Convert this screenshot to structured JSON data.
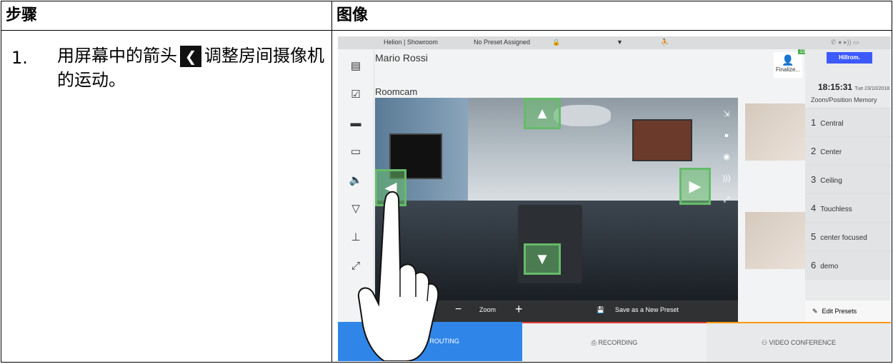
{
  "table": {
    "header_steps": "步骤",
    "header_image": "图像",
    "step_number": "1.",
    "step_text_before": "用屏幕中的箭头",
    "step_text_after": "调整房间摄像机的运动。"
  },
  "device": {
    "topbar": {
      "location": "Helion | Showroom",
      "preset_status": "No Preset Assigned"
    },
    "patient_name": "Mario Rossi",
    "finalize_label": "Finalize...",
    "finalize_badge": "13",
    "logo": "Hillrom.",
    "time": "18:15:31",
    "date": "Tue 23/10/2018",
    "zoom_memory_label": "Zoom/Position Memory",
    "presets": [
      {
        "num": "1",
        "name": "Central"
      },
      {
        "num": "2",
        "name": "Center"
      },
      {
        "num": "3",
        "name": "Ceiling"
      },
      {
        "num": "4",
        "name": "Touchless"
      },
      {
        "num": "5",
        "name": "center focused"
      },
      {
        "num": "6",
        "name": "demo"
      }
    ],
    "edit_presets": "Edit Presets",
    "camera_title": "Roomcam",
    "zoom_label": "Zoom",
    "save_preset": "Save as a New Preset",
    "tabs": {
      "video_routing": "VIDEO ROUTING",
      "recording": "RECORDING",
      "video_conference": "VIDEO CONFERENCE"
    }
  },
  "colors": {
    "accent": "#2f86e8",
    "arrow_green": "#66bb6a"
  }
}
